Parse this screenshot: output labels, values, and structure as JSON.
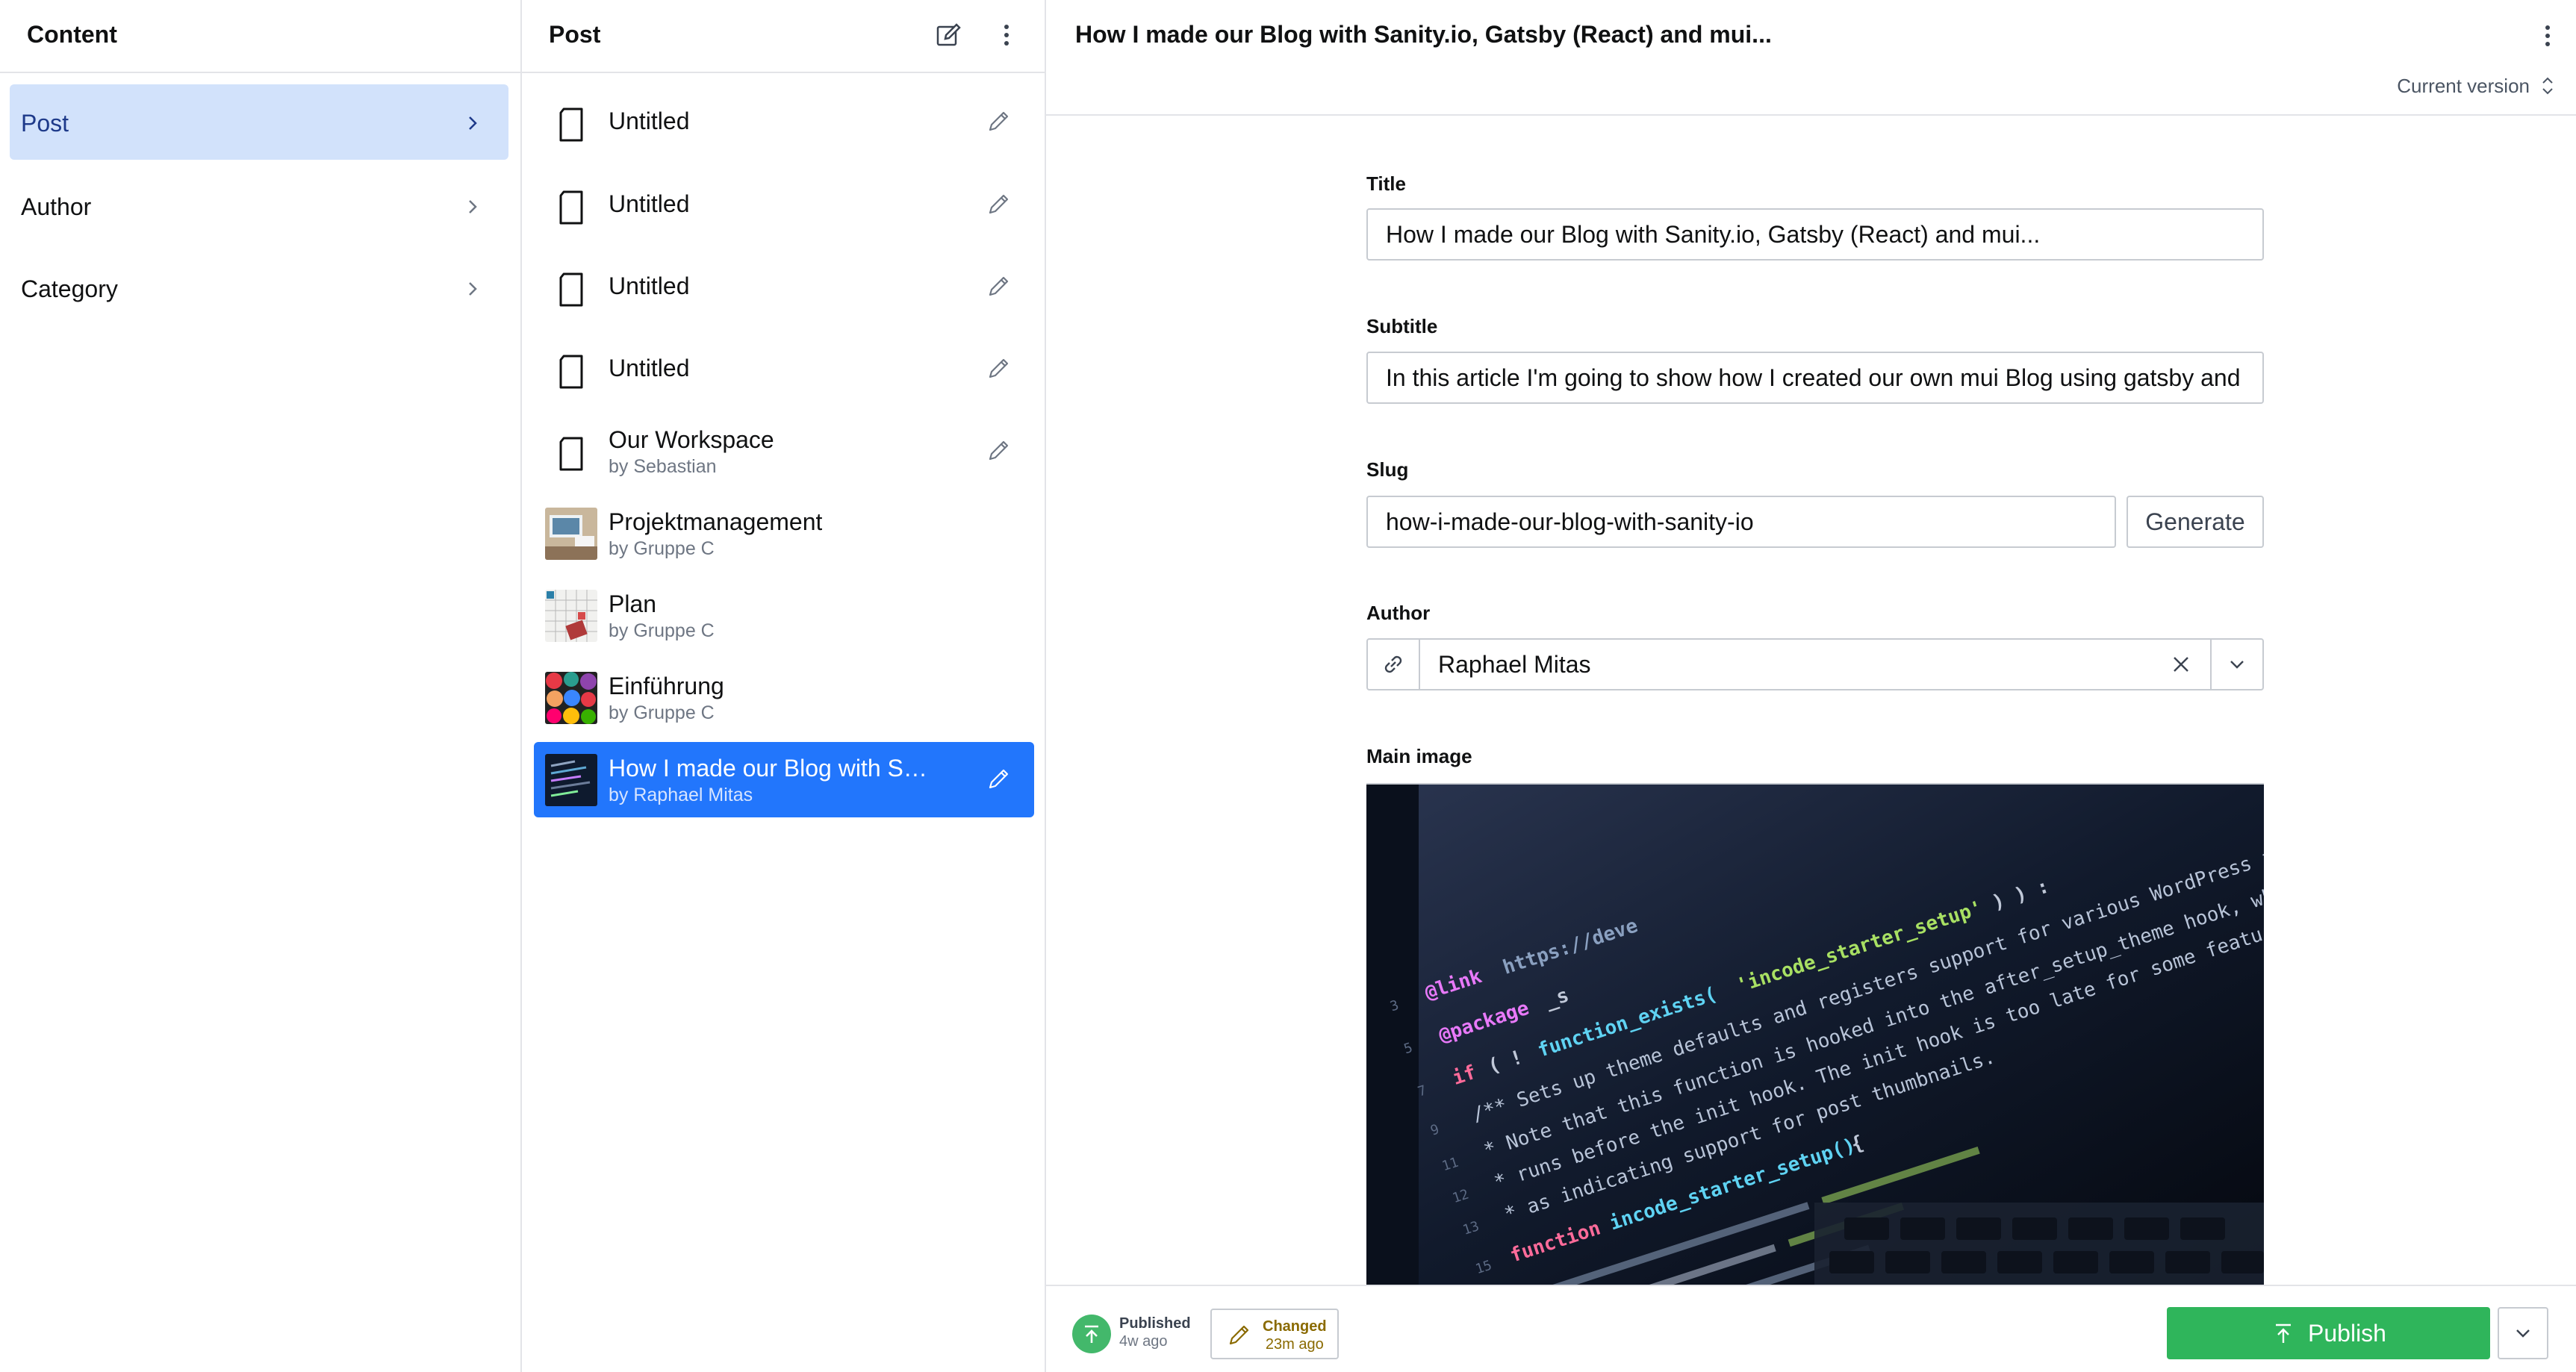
{
  "content_pane": {
    "title": "Content",
    "items": [
      {
        "label": "Post",
        "active": true
      },
      {
        "label": "Author",
        "active": false
      },
      {
        "label": "Category",
        "active": false
      }
    ]
  },
  "post_pane": {
    "title": "Post",
    "items": [
      {
        "title": "Untitled",
        "subtitle": ""
      },
      {
        "title": "Untitled",
        "subtitle": ""
      },
      {
        "title": "Untitled",
        "subtitle": ""
      },
      {
        "title": "Untitled",
        "subtitle": ""
      },
      {
        "title": "Our Workspace",
        "subtitle": "by Sebastian"
      },
      {
        "title": "Projektmanagement",
        "subtitle": "by Gruppe C"
      },
      {
        "title": "Plan",
        "subtitle": "by Gruppe C"
      },
      {
        "title": "Einführung",
        "subtitle": "by Gruppe C"
      },
      {
        "title": "How I made our Blog with Sanity.io, Gatsby (React) and mui...",
        "subtitle": "by Raphael Mitas"
      }
    ]
  },
  "editor": {
    "title": "How I made our Blog with Sanity.io, Gatsby (React) and mui...",
    "version_label": "Current version",
    "fields": {
      "title_label": "Title",
      "title_value": "How I made our Blog with Sanity.io, Gatsby (React) and mui...",
      "subtitle_label": "Subtitle",
      "subtitle_value": "In this article I'm going to show how I created our own mui Blog using gatsby and",
      "slug_label": "Slug",
      "slug_value": "how-i-made-our-blog-with-sanity-io",
      "generate_label": "Generate",
      "author_label": "Author",
      "author_value": "Raphael Mitas",
      "main_image_label": "Main image"
    },
    "footer": {
      "published_label": "Published",
      "published_time": "4w ago",
      "changed_label": "Changed",
      "changed_time": "23m ago",
      "publish_button": "Publish"
    }
  },
  "colors": {
    "accent": "#2276fc",
    "active_nav": "#d2e2fb",
    "publish_green": "#2fb55b"
  }
}
